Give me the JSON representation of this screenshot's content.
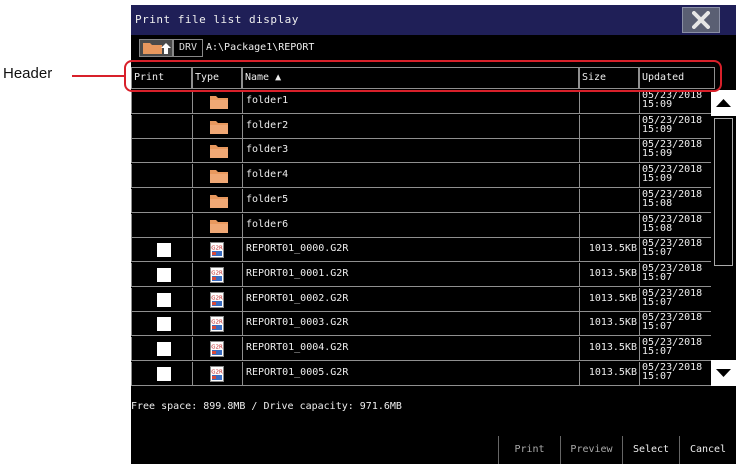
{
  "callout": {
    "label": "Header"
  },
  "window": {
    "title": "Print file list display",
    "path": {
      "drive_label": "DRV",
      "path": "A:\\Package1\\REPORT"
    }
  },
  "table": {
    "columns": [
      "Print",
      "Type",
      "Name ▲",
      "Size",
      "Updated"
    ],
    "rows": [
      {
        "kind": "folder",
        "name": "folder1",
        "size": "",
        "date": "05/23/2018",
        "time": "15:09"
      },
      {
        "kind": "folder",
        "name": "folder2",
        "size": "",
        "date": "05/23/2018",
        "time": "15:09"
      },
      {
        "kind": "folder",
        "name": "folder3",
        "size": "",
        "date": "05/23/2018",
        "time": "15:09"
      },
      {
        "kind": "folder",
        "name": "folder4",
        "size": "",
        "date": "05/23/2018",
        "time": "15:09"
      },
      {
        "kind": "folder",
        "name": "folder5",
        "size": "",
        "date": "05/23/2018",
        "time": "15:08"
      },
      {
        "kind": "folder",
        "name": "folder6",
        "size": "",
        "date": "05/23/2018",
        "time": "15:08"
      },
      {
        "kind": "file",
        "name": "REPORT01_0000.G2R",
        "size": "1013.5KB",
        "date": "05/23/2018",
        "time": "15:07",
        "checked": false
      },
      {
        "kind": "file",
        "name": "REPORT01_0001.G2R",
        "size": "1013.5KB",
        "date": "05/23/2018",
        "time": "15:07",
        "checked": false
      },
      {
        "kind": "file",
        "name": "REPORT01_0002.G2R",
        "size": "1013.5KB",
        "date": "05/23/2018",
        "time": "15:07",
        "checked": false
      },
      {
        "kind": "file",
        "name": "REPORT01_0003.G2R",
        "size": "1013.5KB",
        "date": "05/23/2018",
        "time": "15:07",
        "checked": false
      },
      {
        "kind": "file",
        "name": "REPORT01_0004.G2R",
        "size": "1013.5KB",
        "date": "05/23/2018",
        "time": "15:07",
        "checked": false
      },
      {
        "kind": "file",
        "name": "REPORT01_0005.G2R",
        "size": "1013.5KB",
        "date": "05/23/2018",
        "time": "15:07",
        "checked": false
      }
    ],
    "file_icon_text": "G2R"
  },
  "status": {
    "free_space": "Free space: 899.8MB / Drive capacity: 971.6MB"
  },
  "footer": {
    "print": "Print",
    "preview": "Preview",
    "select_all": "Select all",
    "cancel_all": "Cancel all"
  },
  "icons": [
    "close-icon",
    "folder-up-icon",
    "folder-icon",
    "g2r-file-icon",
    "scroll-up-icon",
    "scroll-down-icon"
  ],
  "colors": {
    "titlebar": "#1f1f57",
    "callout": "#d8202a",
    "folder": "#e8985e"
  }
}
